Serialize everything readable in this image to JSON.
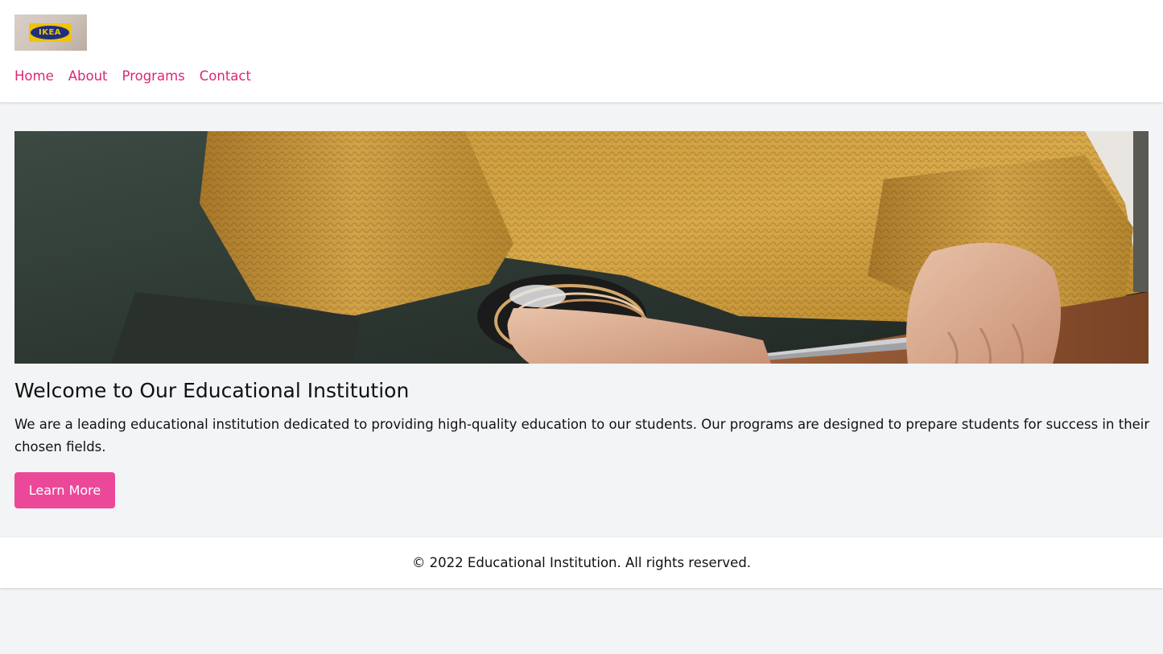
{
  "header": {
    "logo": {
      "text": "IKEA",
      "icon": "ikea-logo"
    },
    "nav": [
      {
        "label": "Home"
      },
      {
        "label": "About"
      },
      {
        "label": "Programs"
      },
      {
        "label": "Contact"
      }
    ]
  },
  "hero": {
    "image": "photo of person in mustard knit sweater with bracelets at a laptop"
  },
  "main": {
    "title": "Welcome to Our Educational Institution",
    "description": "We are a leading educational institution dedicated to providing high-quality education to our students. Our programs are designed to prepare students for success in their chosen fields.",
    "button_label": "Learn More"
  },
  "footer": {
    "text": "© 2022 Educational Institution. All rights reserved."
  },
  "colors": {
    "accent": "#ec4899",
    "nav_link": "#db2777",
    "page_bg": "#f3f4f6",
    "surface": "#ffffff"
  }
}
